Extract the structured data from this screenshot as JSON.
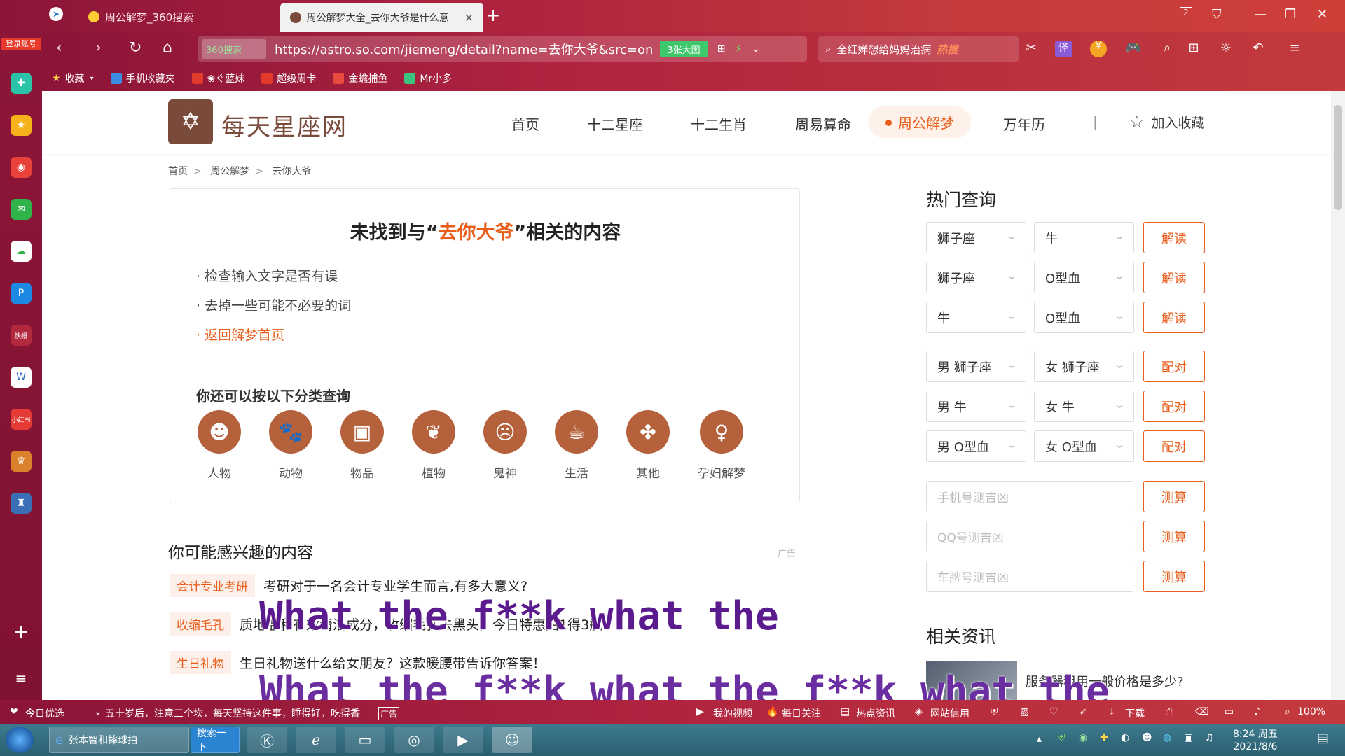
{
  "browser": {
    "tabs": [
      {
        "label": "周公解梦_360搜索"
      },
      {
        "label": "周公解梦大全_去你大爷是什么意"
      }
    ],
    "url": "https://astro.so.com/jiemeng/detail?name=去你大爷&src=on",
    "secure_label": "360搜索",
    "images_badge": "3张大图",
    "search_text": "全红婵想给妈妈治病",
    "search_hot": "热搜",
    "translate_label": "译",
    "login_label": "登录账号",
    "tab_count": "2"
  },
  "bookmarks": [
    {
      "label": "收藏"
    },
    {
      "label": "手机收藏夹"
    },
    {
      "label": "❀ぐ蓝妹"
    },
    {
      "label": "超级周卡"
    },
    {
      "label": "金蟾捕鱼"
    },
    {
      "label": "Mr小多"
    }
  ],
  "site": {
    "name": "每天星座网",
    "nav": [
      "首页",
      "十二星座",
      "十二生肖",
      "周易算命",
      "周公解梦",
      "万年历"
    ],
    "separator": "|",
    "favorite": "加入收藏"
  },
  "breadcrumb": [
    "首页",
    "周公解梦",
    "去你大爷"
  ],
  "not_found": {
    "prefix": "未找到与“",
    "keyword": "去你大爷",
    "suffix": "”相关的内容",
    "tips": [
      "· 检查输入文字是否有误",
      "· 去掉一些可能不必要的词",
      "· 返回解梦首页"
    ],
    "category_title": "你还可以按以下分类查询",
    "categories": [
      "人物",
      "动物",
      "物品",
      "植物",
      "鬼神",
      "生活",
      "其他",
      "孕妇解梦"
    ]
  },
  "interest": {
    "title": "你可能感兴趣的内容",
    "ad": "广告",
    "items": [
      {
        "tag": "会计专业考研",
        "text": "考研对于一名会计专业学生而言,有多大意义?"
      },
      {
        "tag": "收缩毛孔",
        "text": "质地温和有效清洁成分，收缩毛孔去黑头，今日特惠拍1得3瓶"
      },
      {
        "tag": "生日礼物",
        "text": "生日礼物送什么给女朋友？这款暖腰带告诉你答案！"
      }
    ]
  },
  "hot": {
    "title": "热门查询",
    "rows": [
      {
        "a": "狮子座",
        "b": "牛",
        "btn": "解读"
      },
      {
        "a": "狮子座",
        "b": "O型血",
        "btn": "解读"
      },
      {
        "a": "牛",
        "b": "O型血",
        "btn": "解读"
      },
      {
        "a": "男 狮子座",
        "b": "女 狮子座",
        "btn": "配对"
      },
      {
        "a": "男 牛",
        "b": "女 牛",
        "btn": "配对"
      },
      {
        "a": "男 O型血",
        "b": "女 O型血",
        "btn": "配对"
      }
    ],
    "inputs": [
      {
        "placeholder": "手机号测吉凶",
        "btn": "测算"
      },
      {
        "placeholder": "QQ号测吉凶",
        "btn": "测算"
      },
      {
        "placeholder": "车牌号测吉凶",
        "btn": "测算"
      }
    ]
  },
  "news": {
    "title": "相关资讯",
    "item": "服务器租用一般价格是多少?"
  },
  "overlay": {
    "line1": "What the f**k what the",
    "line2": "What the f**k what the f**k what the"
  },
  "statusbar": {
    "today": "今日优选",
    "ticker": "五十岁后，注意三个坎，每天坚持这件事，睡得好，吃得香",
    "ad": "广告",
    "video": "我的视频",
    "daily": "每日关注",
    "news": "热点资讯",
    "credit": "网站信用",
    "download": "下载",
    "zoom": "100%"
  },
  "taskbar": {
    "task1": "张本智和摔球拍",
    "task1_btn": "搜索一下",
    "time": "8:24 周五",
    "date": "2021/8/6"
  }
}
